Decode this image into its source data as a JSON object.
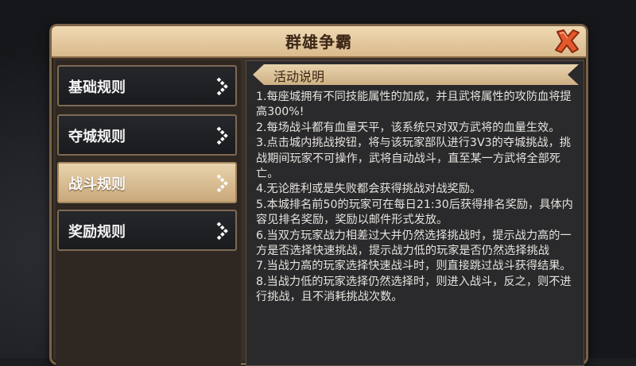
{
  "window": {
    "title": "群雄争霸",
    "close_icon": "close-x-icon"
  },
  "menu": {
    "items": [
      {
        "label": "基础规则",
        "active": false
      },
      {
        "label": "夺城规则",
        "active": false
      },
      {
        "label": "战斗规则",
        "active": true
      },
      {
        "label": "奖励规则",
        "active": false
      }
    ],
    "arrow_icon": "chevron-right-icon"
  },
  "section": {
    "title": "活动说明",
    "rules": [
      "1.每座城拥有不同技能属性的加成，并且武将属性的攻防血将提高300%!",
      "2.每场战斗都有血量天平，该系统只对双方武将的血量生效。",
      "3.点击城内挑战按钮，将与该玩家部队进行3V3的夺城挑战，挑战期间玩家不可操作，武将自动战斗，直至某一方武将全部死亡。",
      "4.无论胜利或是失败都会获得挑战对战奖励。",
      "5.本城排名前50的玩家可在每日21:30后获得排名奖励，具体内容见排名奖励，奖励以邮件形式发放。",
      "6.当双方玩家战力相差过大并仍然选择挑战时，提示战力高的一方是否选择快速挑战，提示战力低的玩家是否仍然选择挑战",
      "7.当战力高的玩家选择快速战斗时，则直接跳过战斗获得结果。",
      "8.当战力低的玩家选择仍然选择时，则进入战斗，反之，则不进行挑战，且不消耗挑战次数。"
    ]
  },
  "colors": {
    "title_bar": "#e6cba0",
    "active_item": "#d9bb8f",
    "close_icon": "#e0532a"
  }
}
